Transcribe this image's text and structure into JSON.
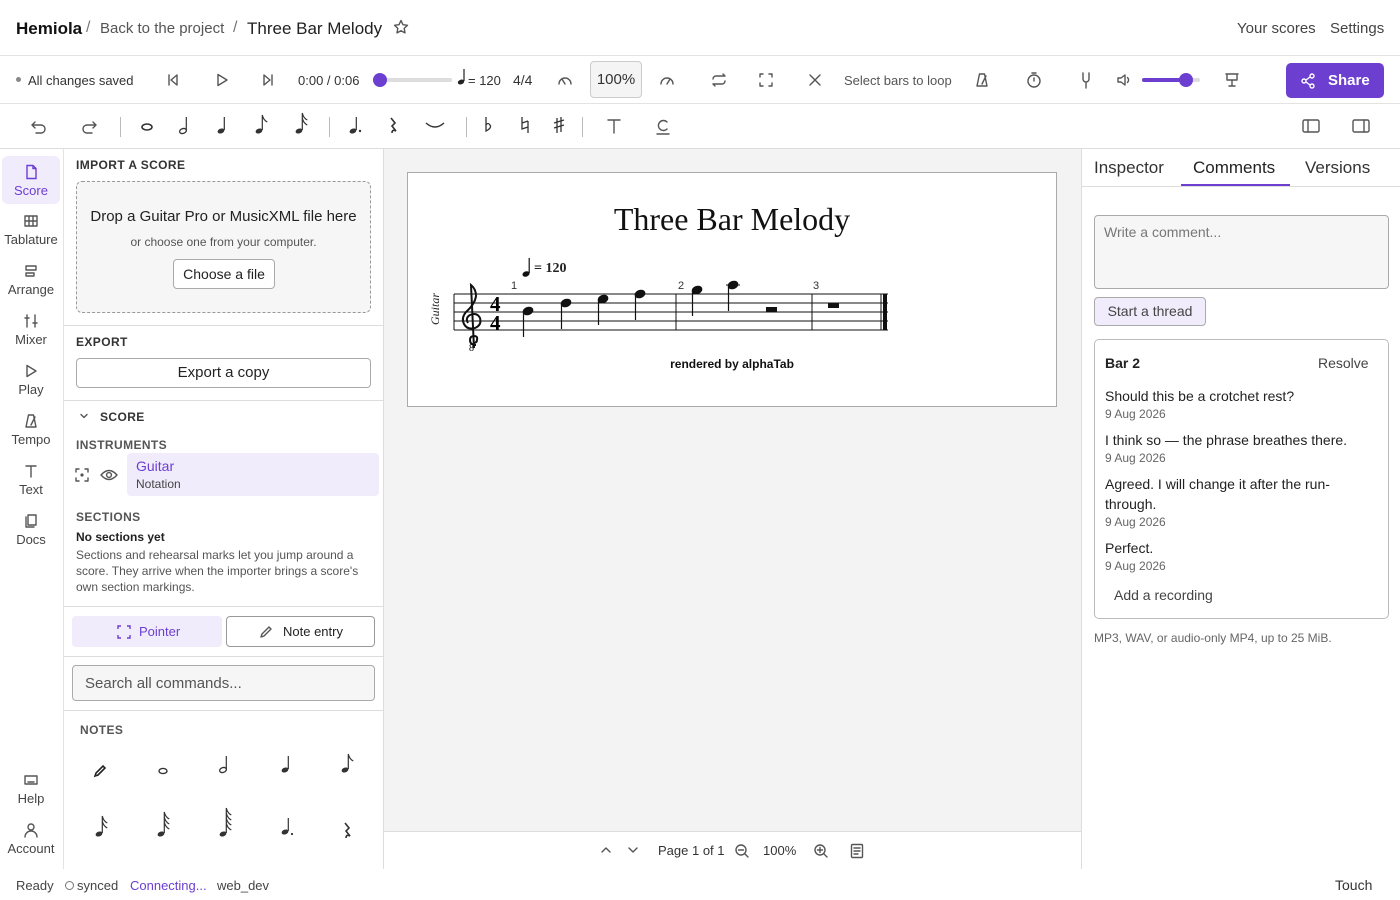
{
  "header": {
    "brand": "Hemiola",
    "sep": "/",
    "back": "Back to the project",
    "title": "Three Bar Melody",
    "your_scores": "Your scores",
    "settings": "Settings"
  },
  "transport": {
    "saved": "All changes saved",
    "time": "0:00 / 0:06",
    "tempo": "= 120",
    "timesig": "4/4",
    "zoom": "100%",
    "loop": "Select bars to loop",
    "share": "Share",
    "progress": 0.0,
    "volume": 0.75
  },
  "rail": {
    "items": [
      "Score",
      "Tablature",
      "Arrange",
      "Mixer",
      "Play",
      "Tempo",
      "Text",
      "Docs"
    ],
    "help": "Help",
    "account": "Account"
  },
  "left": {
    "import": {
      "title": "IMPORT A SCORE",
      "drop": "Drop a Guitar Pro or MusicXML file here",
      "choose_hint": "or choose one from your computer.",
      "choose_btn": "Choose a file"
    },
    "export": {
      "title": "EXPORT",
      "btn": "Export a copy"
    },
    "score": {
      "title": "SCORE",
      "instruments": "INSTRUMENTS",
      "inst_name": "Guitar",
      "inst_type": "Notation",
      "sections": "SECTIONS",
      "no_sections": "No sections yet",
      "desc": "Sections and rehearsal marks let you jump around a score. They arrive when the importer brings a score's own section markings."
    },
    "modes": {
      "pointer": "Pointer",
      "note_entry": "Note entry"
    },
    "search": {
      "placeholder": "Search all commands..."
    },
    "notes": {
      "title": "NOTES"
    }
  },
  "score": {
    "title": "Three Bar Melody",
    "tempo": "= 120",
    "instrument": "Guitar",
    "bars": [
      "1",
      "2",
      "3"
    ],
    "credit": "rendered by alphaTab"
  },
  "canvas_footer": {
    "page": "Page 1 of 1",
    "zoom": "100%"
  },
  "right": {
    "tabs": [
      "Inspector",
      "Comments",
      "Versions"
    ],
    "active_tab": "Comments",
    "comment_placeholder": "Write a comment...",
    "start_thread": "Start a thread",
    "thread": {
      "title": "Bar 2",
      "resolve": "Resolve",
      "comments": [
        {
          "text": "Should this be a crotchet rest?",
          "date": "9 Aug 2026"
        },
        {
          "text": "I think so — the phrase breathes there.",
          "date": "9 Aug 2026"
        },
        {
          "text": "Agreed. I will change it after the run-through.",
          "date": "9 Aug 2026"
        },
        {
          "text": "Perfect.",
          "date": "9 Aug 2026"
        }
      ],
      "add_recording": "Add a recording"
    },
    "hint": "MP3, WAV, or audio-only MP4, up to 25 MiB."
  },
  "status": {
    "ready": "Ready",
    "synced": "synced",
    "connecting": "Connecting...",
    "env": "web_dev",
    "touch": "Touch"
  },
  "colors": {
    "accent": "#6c3fd1",
    "accent_light": "#f1ecfb",
    "connecting": "#6c3fd1"
  }
}
